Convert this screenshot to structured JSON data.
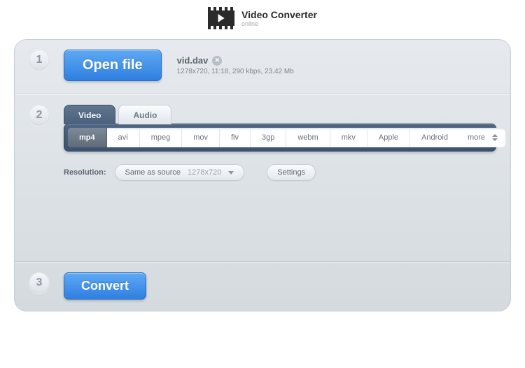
{
  "app": {
    "title": "Video Converter",
    "subtitle": "online"
  },
  "step1": {
    "num": "1",
    "open_label": "Open file",
    "file_name": "vid.dav",
    "file_meta": "1278x720, 11:18, 290 kbps, 23.42 Mb"
  },
  "step2": {
    "num": "2",
    "tabs": {
      "video": "Video",
      "audio": "Audio"
    },
    "formats": [
      "mp4",
      "avi",
      "mpeg",
      "mov",
      "flv",
      "3gp",
      "webm",
      "mkv",
      "Apple",
      "Android"
    ],
    "more_label": "more",
    "resolution_label": "Resolution:",
    "resolution_mode": "Same as source",
    "resolution_value": "1278x720",
    "settings_label": "Settings"
  },
  "step3": {
    "num": "3",
    "convert_label": "Convert"
  }
}
